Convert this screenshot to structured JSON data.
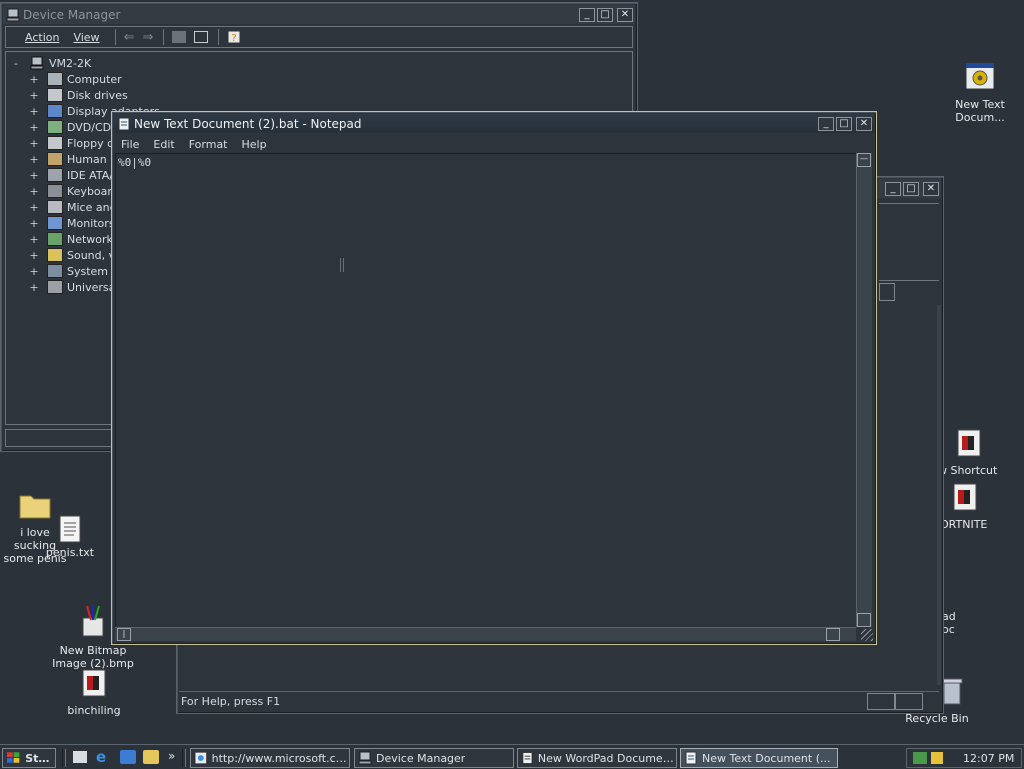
{
  "desktop": {
    "icons": [
      {
        "id": "new-text-doc",
        "label": "New Text\nDocum..."
      },
      {
        "id": "shortcut",
        "label": "w Shortcut"
      },
      {
        "id": "fortnite",
        "label": "ORTNITE"
      },
      {
        "id": "ad-oc",
        "label": "ad\noc"
      },
      {
        "id": "recycle-bin",
        "label": "Recycle Bin"
      },
      {
        "id": "folder",
        "label": "i love sucking\nsome penis"
      },
      {
        "id": "penis-txt",
        "label": "penis.txt"
      },
      {
        "id": "bitmap",
        "label": "New Bitmap\nImage (2).bmp"
      },
      {
        "id": "binchiling",
        "label": "binchiling"
      }
    ]
  },
  "device_manager": {
    "title": "Device Manager",
    "menu": {
      "action": "Action",
      "view": "View"
    },
    "root": "VM2-2K",
    "items": [
      "Computer",
      "Disk drives",
      "Display adapters",
      "DVD/CD-R",
      "Floppy dis",
      "Human In",
      "IDE ATA/A",
      "Keyboard",
      "Mice and",
      "Monitors",
      "Network a",
      "Sound, vi",
      "System de",
      "Universal"
    ]
  },
  "wordpad": {
    "status": "For Help, press F1"
  },
  "notepad": {
    "title": "New Text Document (2).bat - Notepad",
    "menu": [
      "File",
      "Edit",
      "Format",
      "Help"
    ],
    "content": "%0|%0"
  },
  "taskbar": {
    "start": "Start",
    "quicklaunch_more": "»",
    "tasks": [
      {
        "label": "http://www.microsoft.co..."
      },
      {
        "label": "Device Manager"
      },
      {
        "label": "New WordPad Document...."
      },
      {
        "label": "New Text Document (..."
      }
    ],
    "clock": "12:07 PM"
  },
  "colors": {
    "desktop_bg": "#2b323a",
    "window_bg": "#2d343c",
    "active_title_text": "#f0f2f4",
    "inactive_title_text": "#8c949c"
  }
}
